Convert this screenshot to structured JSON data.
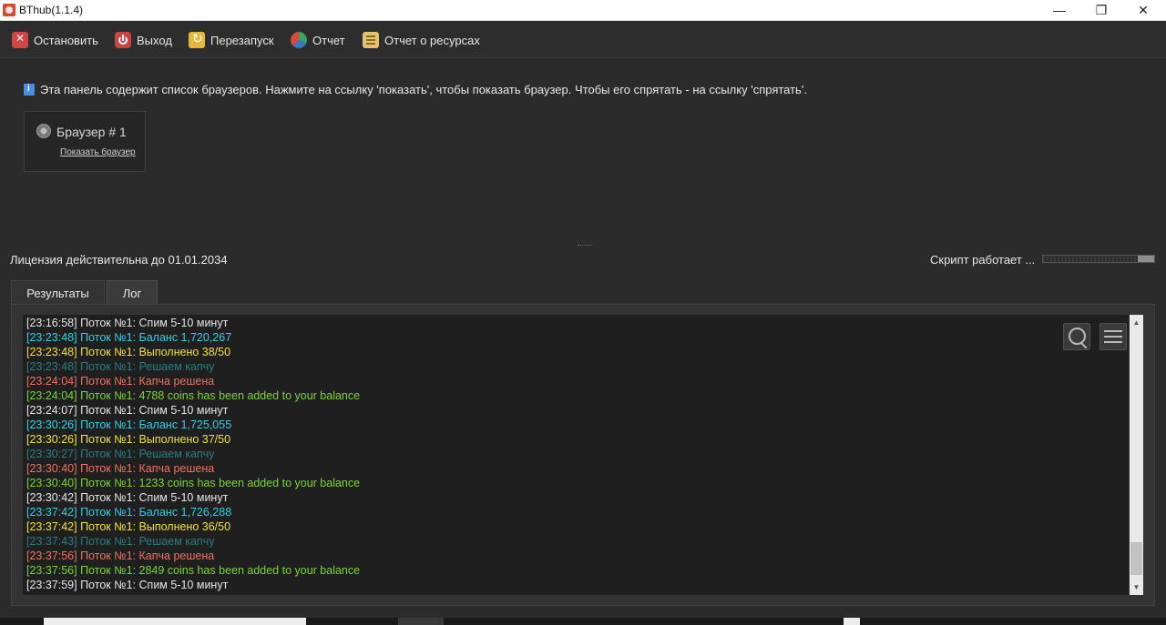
{
  "window": {
    "title": "BThub(1.1.4)",
    "minimize": "—",
    "maximize": "❐",
    "close": "✕"
  },
  "toolbar": {
    "stop_label": "Остановить",
    "exit_label": "Выход",
    "restart_label": "Перезапуск",
    "report_label": "Отчет",
    "resources_label": "Отчет о ресурсах"
  },
  "info_text": "Эта панель содержит список браузеров. Нажмите на ссылку 'показать', чтобы показать браузер. Чтобы его спрятать - на ссылку 'спрятать'.",
  "browser": {
    "name": "Браузер # 1",
    "link": "Показать браузер"
  },
  "status": {
    "license": "Лицензия действительна до 01.01.2034",
    "script": "Скрипт работает ...",
    "progress_fraction": 0.15
  },
  "tabs": [
    {
      "label": "Результаты"
    },
    {
      "label": "Лог"
    }
  ],
  "log": [
    {
      "text": "[23:16:58] Поток №1: Спим 5-10 минут",
      "color": "white"
    },
    {
      "text": "[23:23:48] Поток №1: Баланс 1,720,267",
      "color": "cyan"
    },
    {
      "text": "[23:23:48] Поток №1: Выполнено 38/50",
      "color": "yellow"
    },
    {
      "text": "[23:23:48] Поток №1: Решаем капчу",
      "color": "teal"
    },
    {
      "text": "[23:24:04] Поток №1: Капча решена",
      "color": "salmon"
    },
    {
      "text": "[23:24:04] Поток №1: 4788 coins has been added to your balance",
      "color": "green"
    },
    {
      "text": "[23:24:07] Поток №1: Спим 5-10 минут",
      "color": "white"
    },
    {
      "text": "[23:30:26] Поток №1: Баланс 1,725,055",
      "color": "cyan"
    },
    {
      "text": "[23:30:26] Поток №1: Выполнено 37/50",
      "color": "yellow"
    },
    {
      "text": "[23:30:27] Поток №1: Решаем капчу",
      "color": "teal"
    },
    {
      "text": "[23:30:40] Поток №1: Капча решена",
      "color": "salmon"
    },
    {
      "text": "[23:30:40] Поток №1: 1233 coins has been added to your balance",
      "color": "green"
    },
    {
      "text": "[23:30:42] Поток №1: Спим 5-10 минут",
      "color": "white"
    },
    {
      "text": "[23:37:42] Поток №1: Баланс 1,726,288",
      "color": "cyan"
    },
    {
      "text": "[23:37:42] Поток №1: Выполнено 36/50",
      "color": "yellow"
    },
    {
      "text": "[23:37:43] Поток №1: Решаем капчу",
      "color": "teal"
    },
    {
      "text": "[23:37:56] Поток №1: Капча решена",
      "color": "salmon"
    },
    {
      "text": "[23:37:56] Поток №1: 2849 coins has been added to your balance",
      "color": "green"
    },
    {
      "text": "[23:37:59] Поток №1: Спим 5-10 минут",
      "color": "white"
    }
  ],
  "scroll": {
    "up": "▲",
    "down": "▼"
  }
}
